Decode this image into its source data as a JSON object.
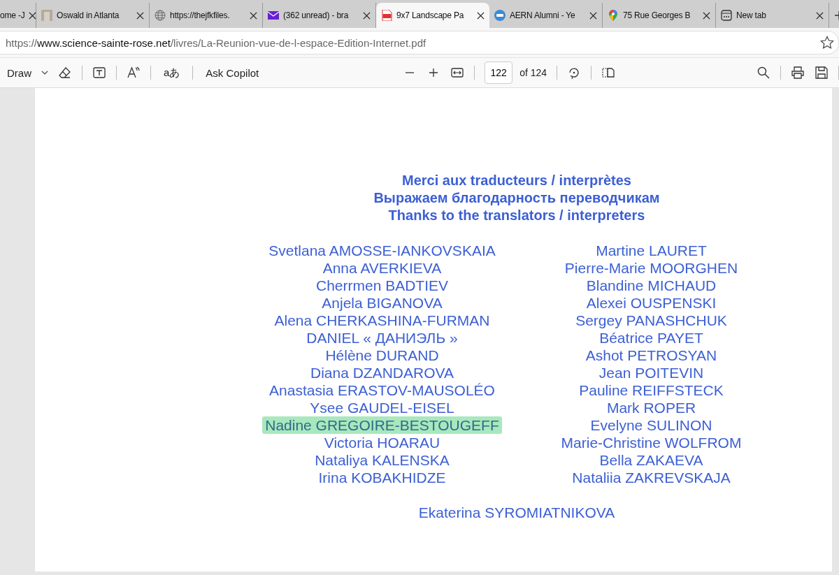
{
  "tabs": [
    {
      "title": "ome -J",
      "selected": false
    },
    {
      "title": "Oswald in Atlanta",
      "selected": false
    },
    {
      "title": "https://thejfkfiles.",
      "selected": false
    },
    {
      "title": "(362 unread) - bra",
      "selected": false
    },
    {
      "title": "9x7 Landscape Pa",
      "selected": true
    },
    {
      "title": "AERN Alumni - Ye",
      "selected": false
    },
    {
      "title": "75 Rue Georges B",
      "selected": false
    },
    {
      "title": "New tab",
      "selected": false
    }
  ],
  "address_bar": {
    "scheme": "https://",
    "host": "www.science-sainte-rose.net",
    "path": "/livres/La-Reunion-vue-de-l-espace-Edition-Internet.pdf"
  },
  "pdf_toolbar": {
    "draw_label": "Draw",
    "translate_label": "aあ",
    "copilot_label": "Ask Copilot",
    "page_number": "122",
    "page_total": "of 124"
  },
  "document": {
    "headings": [
      "Merci aux traducteurs / interprètes",
      "Выражаем благодарность переводчикам",
      "Thanks to the translators / interpreters"
    ],
    "left_names": [
      {
        "name": "Svetlana AMOSSE-IANKOVSKAIA",
        "highlighted": false
      },
      {
        "name": "Anna AVERKIEVA",
        "highlighted": false
      },
      {
        "name": "Cherrmen BADTIEV",
        "highlighted": false
      },
      {
        "name": "Anjela BIGANOVA",
        "highlighted": false
      },
      {
        "name": "Alena CHERKASHINA-FURMAN",
        "highlighted": false
      },
      {
        "name": "DANIEL « ДАНИЭЛЬ »",
        "highlighted": false
      },
      {
        "name": "Hélène DURAND",
        "highlighted": false
      },
      {
        "name": "Diana DZANDAROVA",
        "highlighted": false
      },
      {
        "name": "Anastasia ERASTOV-MAUSOLÉO",
        "highlighted": false
      },
      {
        "name": "Ysee GAUDEL-EISEL",
        "highlighted": false
      },
      {
        "name": "Nadine GREGOIRE-BESTOUGEFF",
        "highlighted": true
      },
      {
        "name": "Victoria HOARAU",
        "highlighted": false
      },
      {
        "name": "Nataliya KALENSKA",
        "highlighted": false
      },
      {
        "name": "Irina KOBAKHIDZE",
        "highlighted": false
      }
    ],
    "right_names": [
      {
        "name": "Martine LAURET",
        "highlighted": false
      },
      {
        "name": "Pierre-Marie MOORGHEN",
        "highlighted": false
      },
      {
        "name": "Blandine MICHAUD",
        "highlighted": false
      },
      {
        "name": "Alexei OUSPENSKI",
        "highlighted": false
      },
      {
        "name": "Sergey PANASHCHUK",
        "highlighted": false
      },
      {
        "name": "Béatrice PAYET",
        "highlighted": false
      },
      {
        "name": "Ashot PETROSYAN",
        "highlighted": false
      },
      {
        "name": "Jean POITEVIN",
        "highlighted": false
      },
      {
        "name": "Pauline REIFFSTECK",
        "highlighted": false
      },
      {
        "name": "Mark ROPER",
        "highlighted": false
      },
      {
        "name": "Evelyne SULINON",
        "highlighted": false
      },
      {
        "name": "Marie-Christine WOLFROM",
        "highlighted": false
      },
      {
        "name": "Bella ZAKAEVA",
        "highlighted": false
      },
      {
        "name": "Nataliia ZAKREVSKAJA",
        "highlighted": false
      }
    ],
    "final_name": {
      "name": "Ekaterina SYROMIATNIKOVA",
      "highlighted": false
    }
  }
}
